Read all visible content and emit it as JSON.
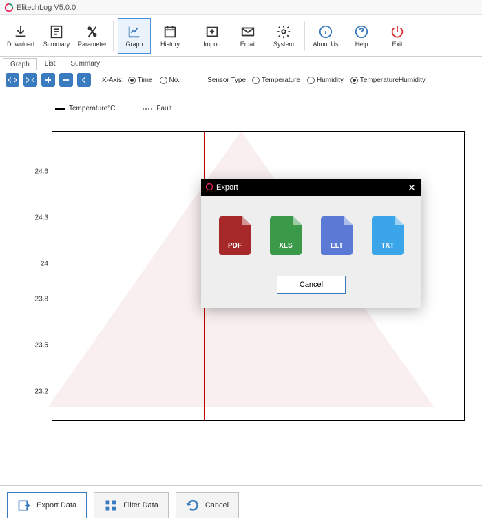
{
  "app": {
    "title": "ElitechLog V5.0.0"
  },
  "toolbar": {
    "download": "Download",
    "summary": "Summary",
    "parameter": "Parameter",
    "graph": "Graph",
    "history": "History",
    "import": "Import",
    "email": "Email",
    "system": "System",
    "aboutus": "About Us",
    "help": "Help",
    "exit": "Exit"
  },
  "tabs": {
    "graph": "Graph",
    "list": "List",
    "summary": "Summary"
  },
  "controls": {
    "xaxis_label": "X-Axis:",
    "time": "Time",
    "no": "No.",
    "sensor_label": "Sensor Type:",
    "temperature": "Temperature",
    "humidity": "Humidity",
    "temphum": "TemperatureHumidity"
  },
  "legend": {
    "temp": "Temperature°C",
    "fault": "Fault"
  },
  "bottom": {
    "export": "Export Data",
    "filter": "Filter Data",
    "cancel": "Cancel"
  },
  "modal": {
    "title": "Export",
    "pdf": "PDF",
    "xls": "XLS",
    "elt": "ELT",
    "txt": "TXT",
    "cancel": "Cancel"
  },
  "chart_data": {
    "type": "line",
    "title": "",
    "xlabel": "",
    "ylabel": "",
    "ylim": [
      23.0,
      24.8
    ],
    "y_ticks": [
      24.6,
      24.3,
      24.0,
      23.8,
      23.5,
      23.2
    ],
    "series": [
      {
        "name": "Temperature°C",
        "values": []
      },
      {
        "name": "Fault",
        "values": []
      }
    ]
  }
}
